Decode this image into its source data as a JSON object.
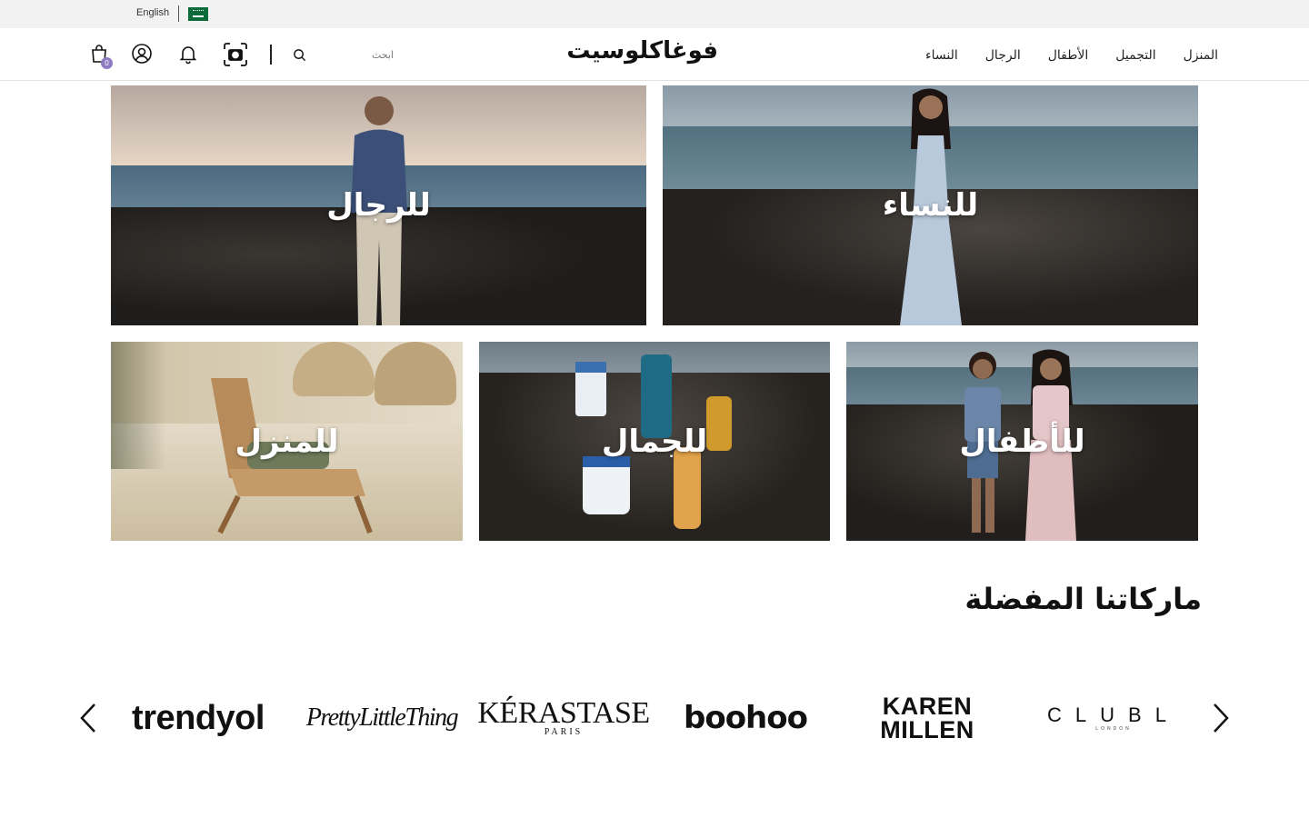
{
  "topbar": {
    "language_link": "English",
    "flag": "saudi-flag"
  },
  "header": {
    "logo": "فوغاكلوسيت",
    "search_placeholder": "ابحث",
    "cart_count": "0",
    "nav": [
      {
        "label": "النساء"
      },
      {
        "label": "الرجال"
      },
      {
        "label": "الأطفال"
      },
      {
        "label": "التجميل"
      },
      {
        "label": "المنزل"
      }
    ]
  },
  "categories": {
    "men": "للرجال",
    "women": "للنساء",
    "home": "للمنزل",
    "beauty": "للجمال",
    "kids": "للأطفال"
  },
  "brands": {
    "title": "ماركاتنا المفضلة",
    "items": [
      {
        "name": "trendyol"
      },
      {
        "name": "PrettyLittleThing"
      },
      {
        "name": "KÉRASTASE",
        "sub": "PARIS"
      },
      {
        "name": "boohoo"
      },
      {
        "name": "KAREN",
        "name2": "MILLEN"
      },
      {
        "name": "CLUBL",
        "sub": "LONDON"
      }
    ]
  },
  "colors": {
    "topbar_bg": "#f2f2f2",
    "badge": "#8e7cc3",
    "flag_green": "#0b6b3a"
  }
}
